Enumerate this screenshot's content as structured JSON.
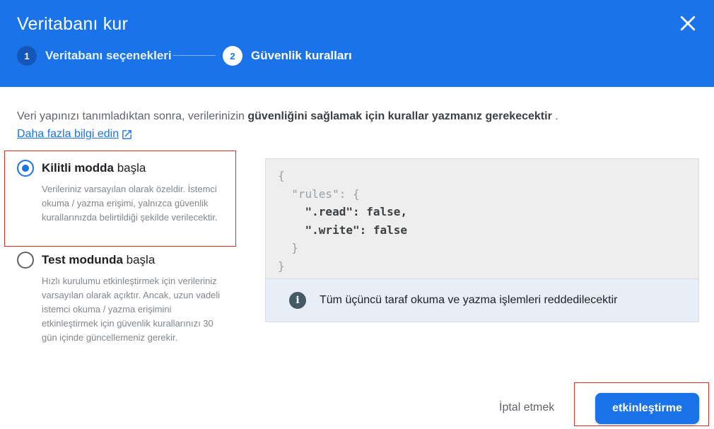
{
  "dialog": {
    "title": "Veritabanı kur",
    "steps": [
      {
        "number": "1",
        "label": "Veritabanı seçenekleri",
        "state": "completed"
      },
      {
        "number": "2",
        "label": "Güvenlik kuralları",
        "state": "active"
      }
    ]
  },
  "intro": {
    "text_before": "Veri yapınızı tanımladıktan sonra, verilerinizin ",
    "text_bold": "güvenliğini sağlamak için kurallar yazmanız gerekecektir",
    "text_after": " .",
    "learn_more": "Daha fazla bilgi edin"
  },
  "options": [
    {
      "title_bold": "Kilitli modda",
      "title_rest": " başla",
      "selected": true,
      "description": "Verileriniz varsayılan olarak özeldir. İstemci okuma / yazma erişimi, yalnızca güvenlik kurallarınızda belirtildiği şekilde verilecektir."
    },
    {
      "title_bold": "Test modunda",
      "title_rest": " başla",
      "selected": false,
      "description": "Hızlı kurulumu etkinleştirmek için verileriniz varsayılan olarak açıktır. Ancak, uzun vadeli istemci okuma / yazma erişimini etkinleştirmek için güvenlik kurallarınızı 30 gün içinde güncellemeniz gerekir."
    }
  ],
  "rules_code": {
    "open_brace": "{",
    "rules_key": "\"rules\"",
    "rules_sep": ": {",
    "read_key": "\".read\"",
    "read_value": ": false,",
    "write_key": "\".write\"",
    "write_value": ": false",
    "inner_close": "}",
    "outer_close": "}"
  },
  "info": {
    "icon_text": "i",
    "text": "Tüm üçüncü taraf okuma ve yazma işlemleri reddedilecektir"
  },
  "footer": {
    "cancel_label": "İptal etmek",
    "enable_label": "etkinleştirme"
  },
  "colors": {
    "header": "#1a73e8",
    "primary": "#1a73e8",
    "highlight_box": "#d93025"
  }
}
